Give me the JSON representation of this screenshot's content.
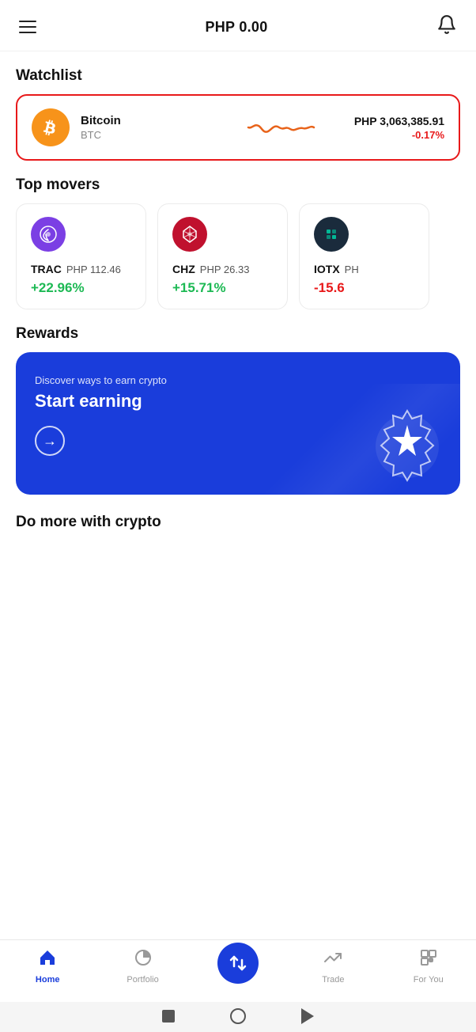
{
  "header": {
    "balance": "PHP 0.00",
    "menu_label": "menu",
    "bell_label": "notifications"
  },
  "watchlist": {
    "section_title": "Watchlist",
    "item": {
      "name": "Bitcoin",
      "symbol": "BTC",
      "price": "PHP 3,063,385.91",
      "change": "-0.17%"
    }
  },
  "top_movers": {
    "section_title": "Top movers",
    "items": [
      {
        "symbol": "TRAC",
        "price": "PHP 112.46",
        "change": "+22.96%",
        "change_type": "positive",
        "icon_color": "#7b3fe4"
      },
      {
        "symbol": "CHZ",
        "price": "PHP 26.33",
        "change": "+15.71%",
        "change_type": "positive",
        "icon_color": "#c0112e"
      },
      {
        "symbol": "IOTX",
        "price": "PH",
        "change": "-15.6",
        "change_type": "negative",
        "icon_color": "#1a2b3c"
      }
    ]
  },
  "rewards": {
    "section_title": "Rewards",
    "subtitle": "Discover ways to earn crypto",
    "title": "Start earning",
    "arrow": "→"
  },
  "do_more": {
    "section_title": "Do more with crypto"
  },
  "bottom_nav": {
    "items": [
      {
        "label": "Home",
        "icon": "home",
        "active": true
      },
      {
        "label": "Portfolio",
        "icon": "portfolio",
        "active": false
      },
      {
        "label": "swap",
        "icon": "swap",
        "active": false,
        "center": true
      },
      {
        "label": "Trade",
        "icon": "trade",
        "active": false
      },
      {
        "label": "For You",
        "icon": "foryou",
        "active": false
      }
    ]
  },
  "system_bar": {
    "square": "back",
    "circle": "home",
    "triangle": "recent"
  }
}
